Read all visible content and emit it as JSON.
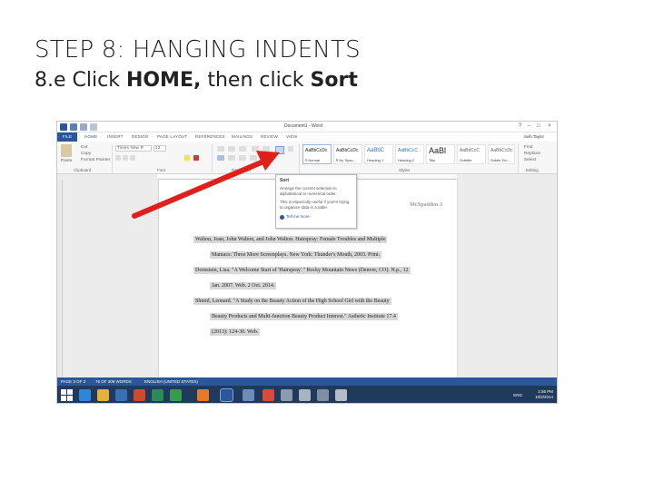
{
  "slide": {
    "title": "STEP 8: HANGING INDENTS",
    "subtitle_prefix": "8.e Click ",
    "subtitle_home": "HOME,",
    "subtitle_middle": " then click ",
    "subtitle_sort": "Sort"
  },
  "window": {
    "title": "Document1 - Word",
    "user": "Josh Taylor",
    "controls": [
      "?",
      "–",
      "□",
      "×"
    ]
  },
  "ribbon_tabs": [
    "FILE",
    "HOME",
    "INSERT",
    "DESIGN",
    "PAGE LAYOUT",
    "REFERENCES",
    "MAILINGS",
    "REVIEW",
    "VIEW"
  ],
  "clipboard": {
    "cut": "Cut",
    "copy": "Copy",
    "paste": "Paste",
    "format_painter": "Format Painter",
    "label": "Clipboard"
  },
  "font": {
    "name": "Times New R",
    "size": "12",
    "label": "Font"
  },
  "paragraph": {
    "label": "Paragraph"
  },
  "styles": {
    "label": "Styles",
    "items": [
      {
        "sample": "AaBbCcDc",
        "name": "¶ Normal"
      },
      {
        "sample": "AaBbCcDc",
        "name": "¶ No Spac..."
      },
      {
        "sample": "AaBbC",
        "name": "Heading 1"
      },
      {
        "sample": "AaBbCcC",
        "name": "Heading 2"
      },
      {
        "sample": "AaBl",
        "name": "Title"
      },
      {
        "sample": "AaBbCcC",
        "name": "Subtitle"
      },
      {
        "sample": "AaBbCcDc",
        "name": "Subtle Em..."
      }
    ]
  },
  "editing": {
    "find": "Find",
    "replace": "Replace",
    "select": "Select",
    "label": "Editing"
  },
  "tooltip": {
    "title": "Sort",
    "text1": "Arrange the current selection in alphabetical or numerical order.",
    "text2": "This is especially useful if you're trying to organize data in a table.",
    "more": "Tell me more"
  },
  "document": {
    "header": "McSpadden 3",
    "citations": [
      "Walton, Joan, John Walton, and John Walton. Hairspray: Female Troubles and Multiple",
      "Maniacs: Three More Screenplays. New York: Thunder's Mouth, 2003. Print.",
      "Dornstein, Lisa. \"A Welcome Start of 'Hairspray'.\" Rocky Mountain News (Denver, CO). N.p., 12",
      "Jan. 2007. Web. 2 Oct. 2014.",
      "Shmid, Leonard. \"A Study on the Beauty Action of the High School Girl with the Beauty",
      "Beauty Products and Multi-function Beauty Product Interest.\" Asthetic Institute 17.4",
      "(2013): 124-30. Web."
    ]
  },
  "statusbar": {
    "page": "PAGE 3 OF 3",
    "words": "76 OF 309 WORDS",
    "language": "ENGLISH (UNITED STATES)"
  },
  "taskbar": {
    "lang": "ENG",
    "time": "1:55 PM",
    "date": "10/2/2014"
  },
  "colors": {
    "word_blue": "#2b579a",
    "arrow_red": "#e0201b",
    "taskbar": "#1f3a5c"
  }
}
